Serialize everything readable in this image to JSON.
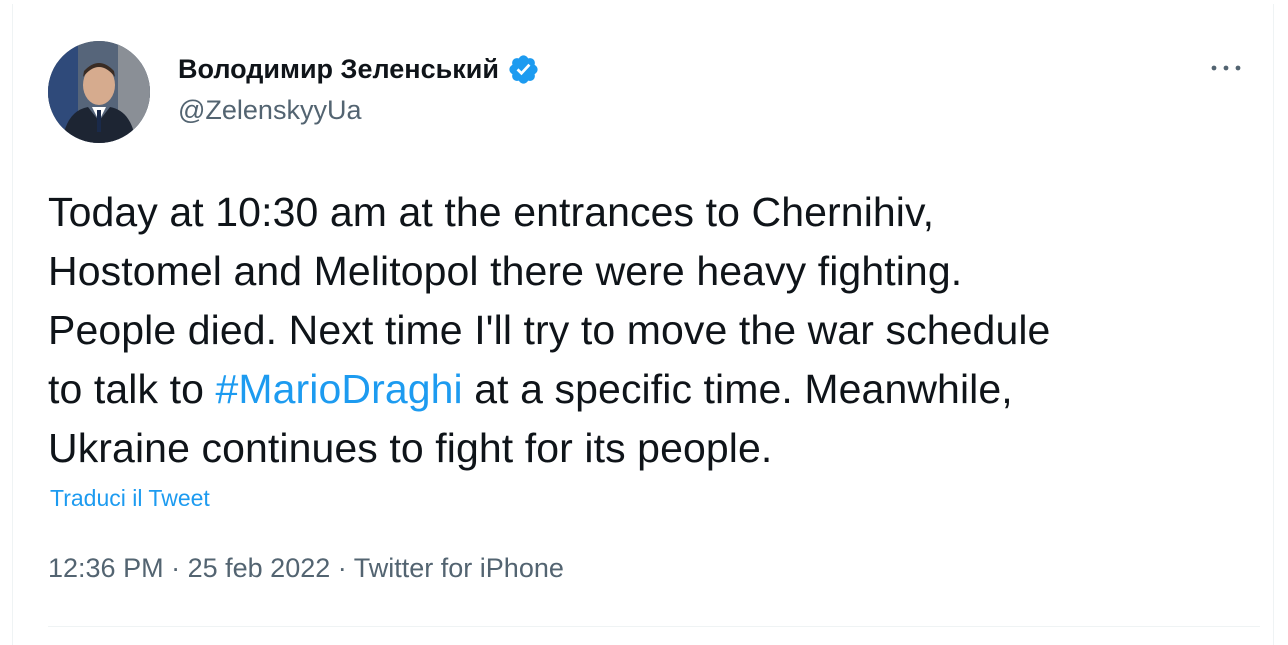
{
  "author": {
    "display_name": "Володимир Зеленський",
    "handle": "@ZelenskyyUa",
    "verified_icon": "verified-badge-icon",
    "avatar": "profile-photo"
  },
  "tweet": {
    "lines": [
      {
        "before": "Today at 10:30 am at the entrances to Chernihiv,",
        "hashtag": "",
        "after": ""
      },
      {
        "before": "Hostomel and Melitopol there were heavy fighting.",
        "hashtag": "",
        "after": ""
      },
      {
        "before": "People died. Next time I'll try to move the war schedule",
        "hashtag": "",
        "after": ""
      },
      {
        "before": "to talk to ",
        "hashtag": "#MarioDraghi",
        "after": " at a specific time. Meanwhile,"
      },
      {
        "before": "Ukraine continues to fight for its people.",
        "hashtag": "",
        "after": ""
      }
    ],
    "translate_label": "Traduci il Tweet",
    "time": "12:36 PM",
    "separator": "·",
    "date": "25 feb 2022",
    "source": "Twitter for iPhone"
  },
  "more_icon": "more-options-icon",
  "colors": {
    "text": "#0f1419",
    "secondary": "#536471",
    "accent": "#1d9bf0"
  }
}
